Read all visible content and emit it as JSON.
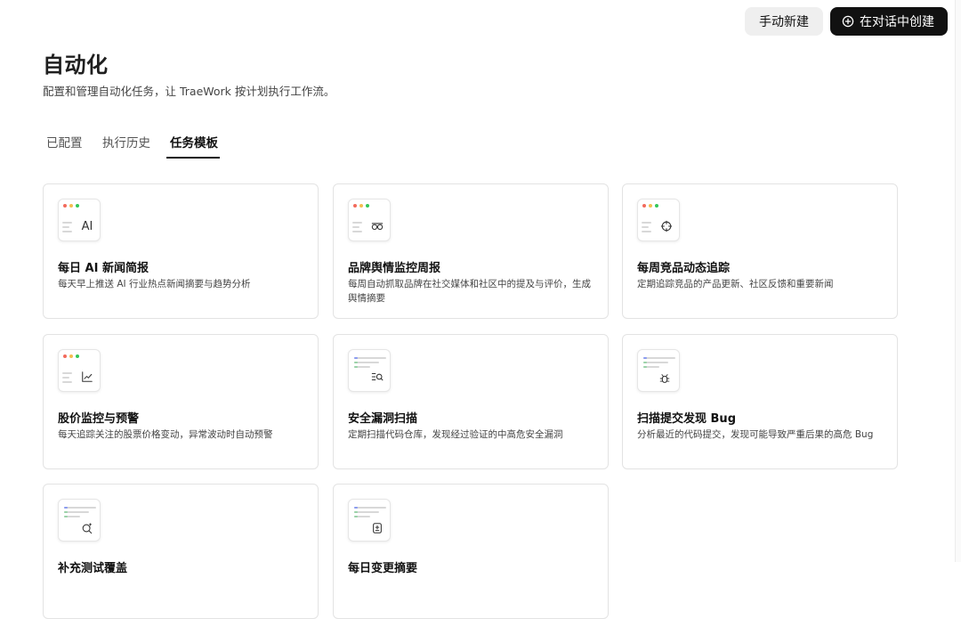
{
  "header": {
    "manual_create_label": "手动新建",
    "chat_create_label": "在对话中创建",
    "title": "自动化",
    "subtitle": "配置和管理自动化任务，让 TraeWork 按计划执行工作流。"
  },
  "tabs": [
    {
      "label": "已配置"
    },
    {
      "label": "执行历史"
    },
    {
      "label": "任务模板"
    }
  ],
  "cards": [
    {
      "title": "每日 AI 新闻简报",
      "desc": "每天早上推送 AI 行业热点新闻摘要与趋势分析",
      "icon": "ai-text-icon",
      "glyph": "AI"
    },
    {
      "title": "品牌舆情监控周报",
      "desc": "每周自动抓取品牌在社交媒体和社区中的提及与评价，生成舆情摘要",
      "icon": "glasses-icon"
    },
    {
      "title": "每周竞品动态追踪",
      "desc": "定期追踪竞品的产品更新、社区反馈和重要新闻",
      "icon": "crosshair-icon"
    },
    {
      "title": "股价监控与预警",
      "desc": "每天追踪关注的股票价格变动，异常波动时自动预警",
      "icon": "trend-chart-icon"
    },
    {
      "title": "安全漏洞扫描",
      "desc": "定期扫描代码仓库，发现经过验证的中高危安全漏洞",
      "icon": "list-search-icon"
    },
    {
      "title": "扫描提交发现 Bug",
      "desc": "分析最近的代码提交，发现可能导致严重后果的高危 Bug",
      "icon": "bug-icon"
    },
    {
      "title": "补充测试覆盖",
      "desc": "",
      "icon": "search-sparkle-icon"
    },
    {
      "title": "每日变更摘要",
      "desc": "",
      "icon": "file-diff-icon"
    }
  ],
  "colors": {
    "dot_red": "#f26a5c",
    "dot_yellow": "#f4bd4f",
    "dot_green": "#34c759",
    "bar_blue": "#8b9cf0",
    "bar_green": "#9ad3a8",
    "bar_gray": "#d8d8d8"
  }
}
